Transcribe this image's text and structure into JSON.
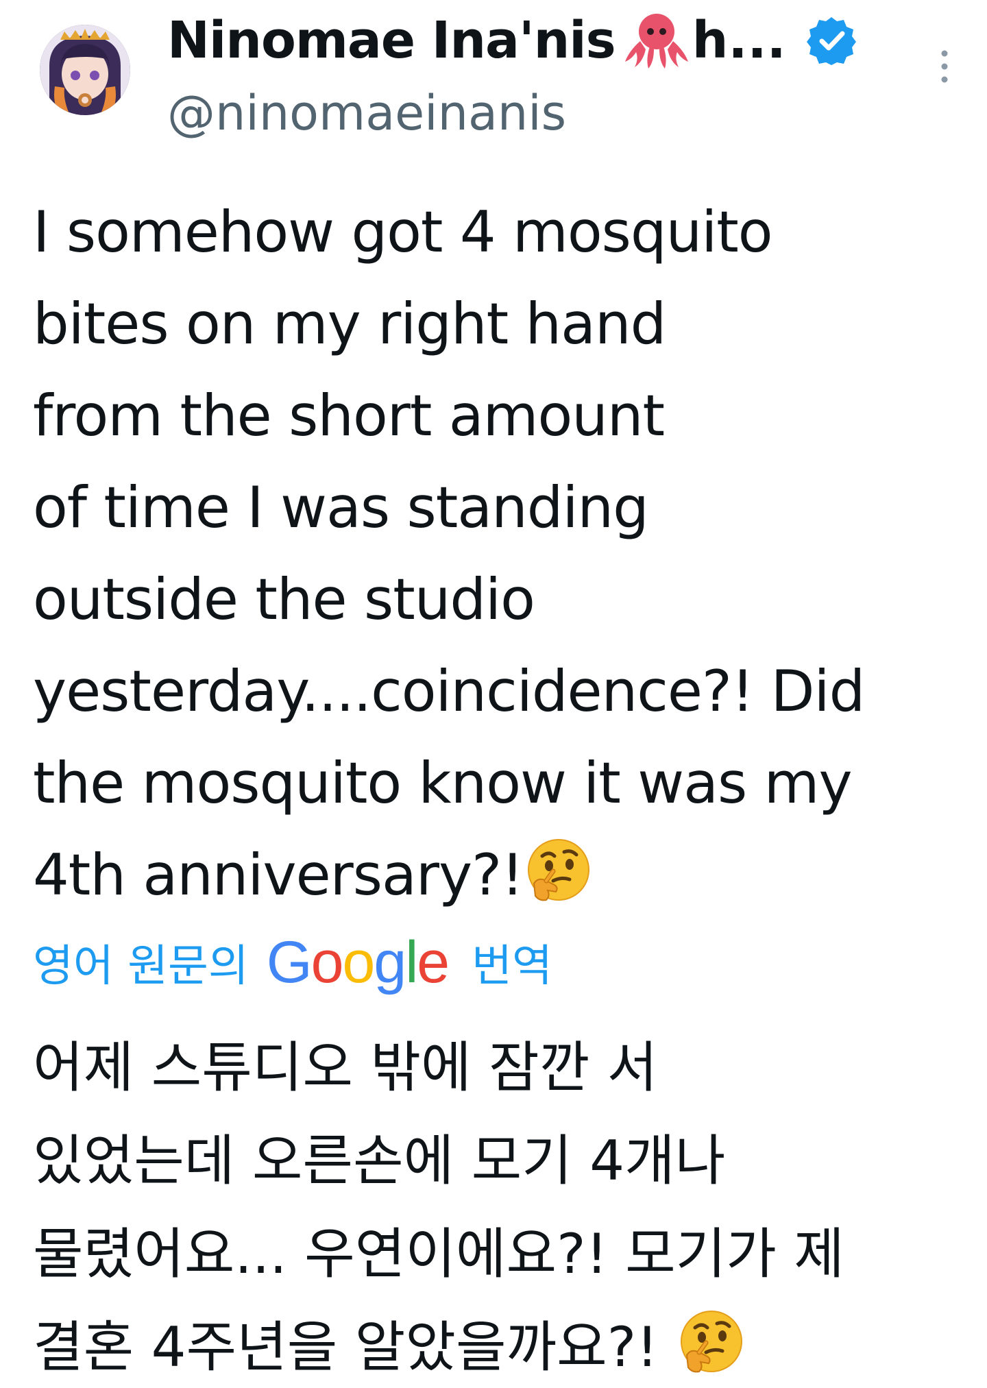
{
  "author": {
    "display_name": "Ninomae Ina'nis",
    "name_suffix": "h...",
    "handle": "@ninomaeinanis",
    "name_emoji": "octopus-icon",
    "verified_icon": "verified-badge-icon",
    "verified_color": "#1d9bf0"
  },
  "menu": {
    "icon": "more-vertical-icon"
  },
  "tweet": {
    "lines": [
      "I somehow got 4 mosquito",
      "bites on my right hand",
      "from the short amount",
      "of time I was standing",
      "outside the studio",
      "yesterday....coincidence?! Did",
      "the mosquito know it was my",
      "4th anniversary?!"
    ],
    "emoji": "thinking-face-icon"
  },
  "translation": {
    "prefix": "영어 원문의",
    "provider_letters": [
      "G",
      "o",
      "o",
      "g",
      "l",
      "e"
    ],
    "suffix": "번역",
    "link_color": "#1d9bf0",
    "lines": [
      "어제 스튜디오 밖에 잠깐 서",
      "있었는데 오른손에 모기 4개나",
      "물렸어요... 우연이에요?! 모기가 제",
      "결혼 4주년을 알았을까요?!"
    ],
    "emoji": "thinking-face-icon"
  }
}
